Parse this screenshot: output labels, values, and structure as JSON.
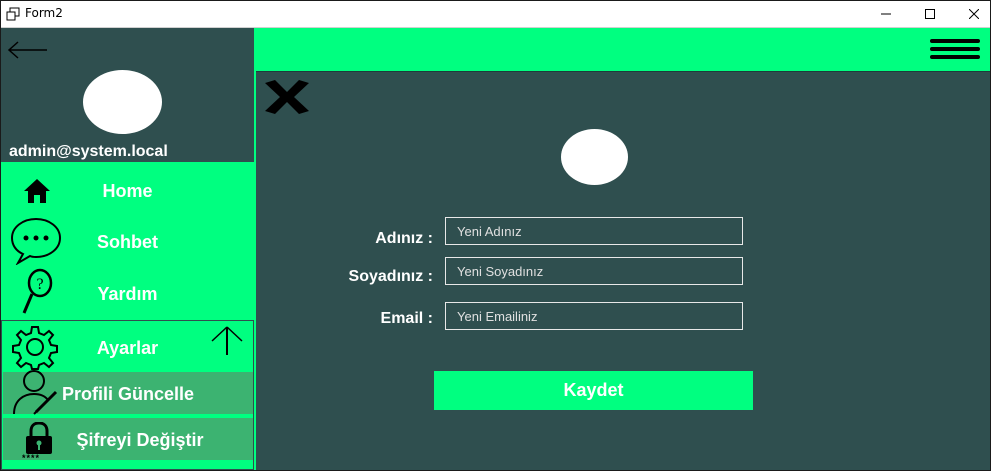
{
  "window": {
    "title": "Form2",
    "icon": "window-restore-icon"
  },
  "sidebar": {
    "user_email": "admin@system.local",
    "nav": [
      {
        "label": "Home",
        "icon": "home-icon"
      },
      {
        "label": "Sohbet",
        "icon": "chat-bubble-icon"
      },
      {
        "label": "Yardım",
        "icon": "help-magnifier-icon"
      },
      {
        "label": "Ayarlar",
        "icon": "gear-icon"
      }
    ],
    "settings_sub": [
      {
        "label": "Profili Güncelle",
        "icon": "user-edit-icon"
      },
      {
        "label": "Şifreyi Değiştir",
        "icon": "lock-icon",
        "icon_caption": "****"
      }
    ]
  },
  "form": {
    "first_name_label": "Adınız :",
    "first_name_placeholder": "Yeni Adınız",
    "last_name_label": "Soyadınız :",
    "last_name_placeholder": "Yeni Soyadınız",
    "email_label": "Email :",
    "email_placeholder": "Yeni Emailiniz",
    "save_label": "Kaydet"
  },
  "colors": {
    "accent": "#00ff80",
    "background": "#2f4f4f",
    "submenu": "#3cb371"
  }
}
